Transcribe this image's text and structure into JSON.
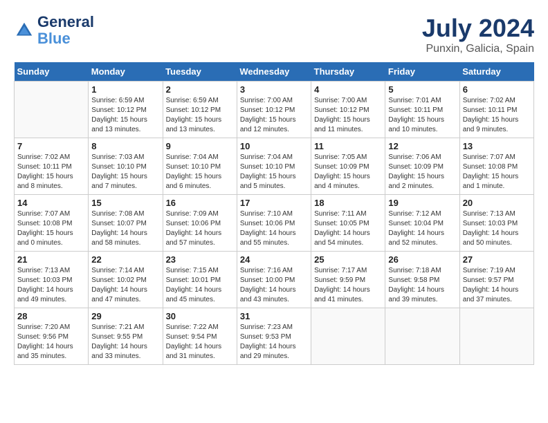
{
  "header": {
    "logo_line1": "General",
    "logo_line2": "Blue",
    "month_year": "July 2024",
    "location": "Punxin, Galicia, Spain"
  },
  "weekdays": [
    "Sunday",
    "Monday",
    "Tuesday",
    "Wednesday",
    "Thursday",
    "Friday",
    "Saturday"
  ],
  "weeks": [
    [
      {
        "day": "",
        "sunrise": "",
        "sunset": "",
        "daylight": ""
      },
      {
        "day": "1",
        "sunrise": "Sunrise: 6:59 AM",
        "sunset": "Sunset: 10:12 PM",
        "daylight": "Daylight: 15 hours and 13 minutes."
      },
      {
        "day": "2",
        "sunrise": "Sunrise: 6:59 AM",
        "sunset": "Sunset: 10:12 PM",
        "daylight": "Daylight: 15 hours and 13 minutes."
      },
      {
        "day": "3",
        "sunrise": "Sunrise: 7:00 AM",
        "sunset": "Sunset: 10:12 PM",
        "daylight": "Daylight: 15 hours and 12 minutes."
      },
      {
        "day": "4",
        "sunrise": "Sunrise: 7:00 AM",
        "sunset": "Sunset: 10:12 PM",
        "daylight": "Daylight: 15 hours and 11 minutes."
      },
      {
        "day": "5",
        "sunrise": "Sunrise: 7:01 AM",
        "sunset": "Sunset: 10:11 PM",
        "daylight": "Daylight: 15 hours and 10 minutes."
      },
      {
        "day": "6",
        "sunrise": "Sunrise: 7:02 AM",
        "sunset": "Sunset: 10:11 PM",
        "daylight": "Daylight: 15 hours and 9 minutes."
      }
    ],
    [
      {
        "day": "7",
        "sunrise": "Sunrise: 7:02 AM",
        "sunset": "Sunset: 10:11 PM",
        "daylight": "Daylight: 15 hours and 8 minutes."
      },
      {
        "day": "8",
        "sunrise": "Sunrise: 7:03 AM",
        "sunset": "Sunset: 10:10 PM",
        "daylight": "Daylight: 15 hours and 7 minutes."
      },
      {
        "day": "9",
        "sunrise": "Sunrise: 7:04 AM",
        "sunset": "Sunset: 10:10 PM",
        "daylight": "Daylight: 15 hours and 6 minutes."
      },
      {
        "day": "10",
        "sunrise": "Sunrise: 7:04 AM",
        "sunset": "Sunset: 10:10 PM",
        "daylight": "Daylight: 15 hours and 5 minutes."
      },
      {
        "day": "11",
        "sunrise": "Sunrise: 7:05 AM",
        "sunset": "Sunset: 10:09 PM",
        "daylight": "Daylight: 15 hours and 4 minutes."
      },
      {
        "day": "12",
        "sunrise": "Sunrise: 7:06 AM",
        "sunset": "Sunset: 10:09 PM",
        "daylight": "Daylight: 15 hours and 2 minutes."
      },
      {
        "day": "13",
        "sunrise": "Sunrise: 7:07 AM",
        "sunset": "Sunset: 10:08 PM",
        "daylight": "Daylight: 15 hours and 1 minute."
      }
    ],
    [
      {
        "day": "14",
        "sunrise": "Sunrise: 7:07 AM",
        "sunset": "Sunset: 10:08 PM",
        "daylight": "Daylight: 15 hours and 0 minutes."
      },
      {
        "day": "15",
        "sunrise": "Sunrise: 7:08 AM",
        "sunset": "Sunset: 10:07 PM",
        "daylight": "Daylight: 14 hours and 58 minutes."
      },
      {
        "day": "16",
        "sunrise": "Sunrise: 7:09 AM",
        "sunset": "Sunset: 10:06 PM",
        "daylight": "Daylight: 14 hours and 57 minutes."
      },
      {
        "day": "17",
        "sunrise": "Sunrise: 7:10 AM",
        "sunset": "Sunset: 10:06 PM",
        "daylight": "Daylight: 14 hours and 55 minutes."
      },
      {
        "day": "18",
        "sunrise": "Sunrise: 7:11 AM",
        "sunset": "Sunset: 10:05 PM",
        "daylight": "Daylight: 14 hours and 54 minutes."
      },
      {
        "day": "19",
        "sunrise": "Sunrise: 7:12 AM",
        "sunset": "Sunset: 10:04 PM",
        "daylight": "Daylight: 14 hours and 52 minutes."
      },
      {
        "day": "20",
        "sunrise": "Sunrise: 7:13 AM",
        "sunset": "Sunset: 10:03 PM",
        "daylight": "Daylight: 14 hours and 50 minutes."
      }
    ],
    [
      {
        "day": "21",
        "sunrise": "Sunrise: 7:13 AM",
        "sunset": "Sunset: 10:03 PM",
        "daylight": "Daylight: 14 hours and 49 minutes."
      },
      {
        "day": "22",
        "sunrise": "Sunrise: 7:14 AM",
        "sunset": "Sunset: 10:02 PM",
        "daylight": "Daylight: 14 hours and 47 minutes."
      },
      {
        "day": "23",
        "sunrise": "Sunrise: 7:15 AM",
        "sunset": "Sunset: 10:01 PM",
        "daylight": "Daylight: 14 hours and 45 minutes."
      },
      {
        "day": "24",
        "sunrise": "Sunrise: 7:16 AM",
        "sunset": "Sunset: 10:00 PM",
        "daylight": "Daylight: 14 hours and 43 minutes."
      },
      {
        "day": "25",
        "sunrise": "Sunrise: 7:17 AM",
        "sunset": "Sunset: 9:59 PM",
        "daylight": "Daylight: 14 hours and 41 minutes."
      },
      {
        "day": "26",
        "sunrise": "Sunrise: 7:18 AM",
        "sunset": "Sunset: 9:58 PM",
        "daylight": "Daylight: 14 hours and 39 minutes."
      },
      {
        "day": "27",
        "sunrise": "Sunrise: 7:19 AM",
        "sunset": "Sunset: 9:57 PM",
        "daylight": "Daylight: 14 hours and 37 minutes."
      }
    ],
    [
      {
        "day": "28",
        "sunrise": "Sunrise: 7:20 AM",
        "sunset": "Sunset: 9:56 PM",
        "daylight": "Daylight: 14 hours and 35 minutes."
      },
      {
        "day": "29",
        "sunrise": "Sunrise: 7:21 AM",
        "sunset": "Sunset: 9:55 PM",
        "daylight": "Daylight: 14 hours and 33 minutes."
      },
      {
        "day": "30",
        "sunrise": "Sunrise: 7:22 AM",
        "sunset": "Sunset: 9:54 PM",
        "daylight": "Daylight: 14 hours and 31 minutes."
      },
      {
        "day": "31",
        "sunrise": "Sunrise: 7:23 AM",
        "sunset": "Sunset: 9:53 PM",
        "daylight": "Daylight: 14 hours and 29 minutes."
      },
      {
        "day": "",
        "sunrise": "",
        "sunset": "",
        "daylight": ""
      },
      {
        "day": "",
        "sunrise": "",
        "sunset": "",
        "daylight": ""
      },
      {
        "day": "",
        "sunrise": "",
        "sunset": "",
        "daylight": ""
      }
    ]
  ]
}
